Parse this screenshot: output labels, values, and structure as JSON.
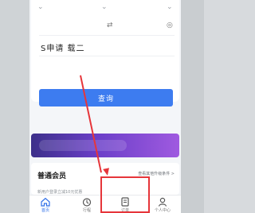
{
  "search": {
    "route_text": "S申请    载二",
    "query_button": "查询"
  },
  "member": {
    "title": "普通会员",
    "link": "查看其他升级条件 >",
    "subtitle": "新用户登录立减10元优惠"
  },
  "tabs": [
    {
      "label": "首页",
      "icon": "home-icon"
    },
    {
      "label": "行程",
      "icon": "trip-icon"
    },
    {
      "label": "订单",
      "icon": "order-icon"
    },
    {
      "label": "个人中心",
      "icon": "user-icon"
    }
  ],
  "colors": {
    "accent": "#3d7cf0",
    "annotation": "#e6353a"
  }
}
